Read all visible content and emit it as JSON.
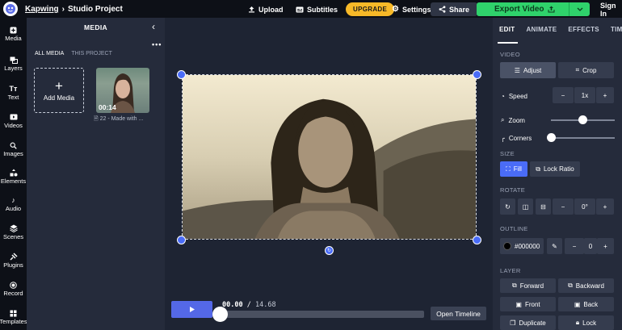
{
  "topbar": {
    "brand": "Kapwing",
    "project": "Studio Project",
    "upload_label": "Upload",
    "subtitles_label": "Subtitles",
    "upgrade_label": "UPGRADE",
    "settings_label": "Settings",
    "share_label": "Share",
    "export_label": "Export Video",
    "signin_label": "Sign In"
  },
  "leftnav": {
    "items": [
      {
        "label": "Media",
        "icon": "media-icon"
      },
      {
        "label": "Layers",
        "icon": "layers-icon"
      },
      {
        "label": "Text",
        "icon": "text-icon"
      },
      {
        "label": "Videos",
        "icon": "videos-icon"
      },
      {
        "label": "Images",
        "icon": "images-icon"
      },
      {
        "label": "Elements",
        "icon": "elements-icon"
      },
      {
        "label": "Audio",
        "icon": "audio-icon"
      },
      {
        "label": "Scenes",
        "icon": "scenes-icon"
      },
      {
        "label": "Plugins",
        "icon": "plugins-icon"
      },
      {
        "label": "Record",
        "icon": "record-icon"
      },
      {
        "label": "Templates",
        "icon": "templates-icon"
      }
    ]
  },
  "media": {
    "title": "MEDIA",
    "tab_all": "ALL MEDIA",
    "tab_project": "THIS PROJECT",
    "add_label": "Add Media",
    "thumb_duration": "00:14",
    "thumb_caption": "22 - Made with ..."
  },
  "player": {
    "current": "00.00",
    "separator": "/",
    "total": "14.68",
    "open_timeline": "Open Timeline"
  },
  "props": {
    "tabs": [
      "EDIT",
      "ANIMATE",
      "EFFECTS",
      "TIMING"
    ],
    "video_section": "VIDEO",
    "adjust": "Adjust",
    "crop": "Crop",
    "speed_label": "Speed",
    "speed_value": "1x",
    "zoom_label": "Zoom",
    "zoom_level": 0.5,
    "corners_label": "Corners",
    "corners_level": 0.0,
    "size_section": "SIZE",
    "fill": "Fill",
    "lock_ratio": "Lock Ratio",
    "rotate_section": "ROTATE",
    "rotate_value": "0°",
    "outline_section": "OUTLINE",
    "outline_color": "#000000",
    "outline_value": "0",
    "layer_section": "LAYER",
    "forward": "Forward",
    "backward": "Backward",
    "front": "Front",
    "back": "Back",
    "duplicate": "Duplicate",
    "lock": "Lock"
  },
  "colors": {
    "accent": "#4a6cf7",
    "export": "#2fd26b",
    "upgrade": "#f7b928"
  }
}
